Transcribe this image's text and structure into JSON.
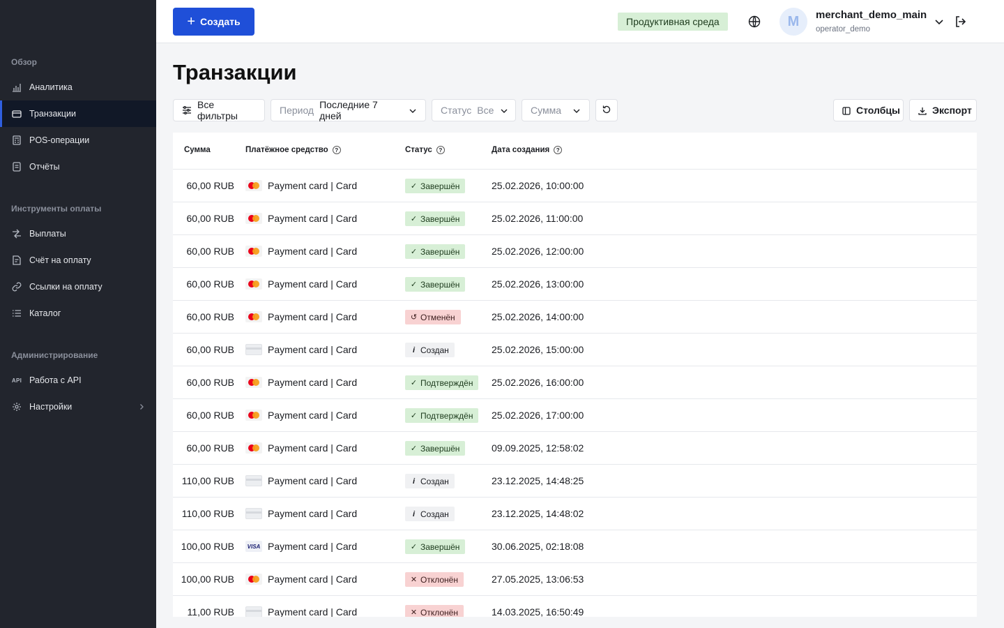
{
  "sidebar": {
    "sections": [
      "Обзор",
      "Инструменты оплаты",
      "Администрирование"
    ],
    "items": [
      {
        "label": "Аналитика",
        "icon": "chart-bars-icon"
      },
      {
        "label": "Транзакции",
        "icon": "wallet-icon",
        "active": true
      },
      {
        "label": "POS-операции",
        "icon": "pos-terminal-icon"
      },
      {
        "label": "Отчёты",
        "icon": "report-icon"
      },
      {
        "label": "Выплаты",
        "icon": "payout-arrow-icon"
      },
      {
        "label": "Счёт на оплату",
        "icon": "invoice-icon"
      },
      {
        "label": "Ссылки на оплату",
        "icon": "link-icon"
      },
      {
        "label": "Каталог",
        "icon": "list-icon"
      },
      {
        "label": "Работа с API",
        "icon": "api-icon",
        "icon_text": "API"
      },
      {
        "label": "Настройки",
        "icon": "gear-icon"
      }
    ]
  },
  "header": {
    "create_label": "Создать",
    "environment": "Продуктивная среда",
    "avatar_letter": "M",
    "account_name": "merchant_demo_main",
    "account_sub": "operator_demo"
  },
  "page": {
    "title": "Транзакции"
  },
  "filters": {
    "all_filters": "Все фильтры",
    "period_label": "Период",
    "period_value": "Последние 7 дней",
    "status_label": "Статус",
    "status_value": "Все",
    "amount_placeholder": "Сумма",
    "columns": "Столбцы",
    "export": "Экспорт"
  },
  "table": {
    "headers": {
      "amount": "Сумма",
      "method": "Платёжное средство",
      "status": "Статус",
      "date": "Дата создания"
    },
    "rows": [
      {
        "amount": "60,00 RUB",
        "card": "mastercard",
        "method": "Payment card | Card",
        "status": "Завершён",
        "status_kind": "ok",
        "date": "25.02.2026, 10:00:00"
      },
      {
        "amount": "60,00 RUB",
        "card": "mastercard",
        "method": "Payment card | Card",
        "status": "Завершён",
        "status_kind": "ok",
        "date": "25.02.2026, 11:00:00"
      },
      {
        "amount": "60,00 RUB",
        "card": "mastercard",
        "method": "Payment card | Card",
        "status": "Завершён",
        "status_kind": "ok",
        "date": "25.02.2026, 12:00:00"
      },
      {
        "amount": "60,00 RUB",
        "card": "mastercard",
        "method": "Payment card | Card",
        "status": "Завершён",
        "status_kind": "ok",
        "date": "25.02.2026, 13:00:00"
      },
      {
        "amount": "60,00 RUB",
        "card": "mastercard",
        "method": "Payment card | Card",
        "status": "Отменён",
        "status_kind": "cancel",
        "date": "25.02.2026, 14:00:00"
      },
      {
        "amount": "60,00 RUB",
        "card": "generic",
        "method": "Payment card | Card",
        "status": "Создан",
        "status_kind": "new",
        "date": "25.02.2026, 15:00:00"
      },
      {
        "amount": "60,00 RUB",
        "card": "mastercard",
        "method": "Payment card | Card",
        "status": "Подтверждён",
        "status_kind": "ok",
        "date": "25.02.2026, 16:00:00"
      },
      {
        "amount": "60,00 RUB",
        "card": "mastercard",
        "method": "Payment card | Card",
        "status": "Подтверждён",
        "status_kind": "ok",
        "date": "25.02.2026, 17:00:00"
      },
      {
        "amount": "60,00 RUB",
        "card": "mastercard",
        "method": "Payment card | Card",
        "status": "Завершён",
        "status_kind": "ok",
        "date": "09.09.2025, 12:58:02"
      },
      {
        "amount": "110,00 RUB",
        "card": "generic",
        "method": "Payment card | Card",
        "status": "Создан",
        "status_kind": "new",
        "date": "23.12.2025, 14:48:25"
      },
      {
        "amount": "110,00 RUB",
        "card": "generic",
        "method": "Payment card | Card",
        "status": "Создан",
        "status_kind": "new",
        "date": "23.12.2025, 14:48:02"
      },
      {
        "amount": "100,00 RUB",
        "card": "visa",
        "card_text": "VISA",
        "method": "Payment card | Card",
        "status": "Завершён",
        "status_kind": "ok",
        "date": "30.06.2025, 02:18:08"
      },
      {
        "amount": "100,00 RUB",
        "card": "mastercard",
        "method": "Payment card | Card",
        "status": "Отклонён",
        "status_kind": "fail",
        "date": "27.05.2025, 13:06:53"
      },
      {
        "amount": "11,00 RUB",
        "card": "generic",
        "method": "Payment card | Card",
        "status": "Отклонён",
        "status_kind": "fail",
        "date": "14.03.2025, 16:50:49"
      }
    ]
  },
  "colors": {
    "sidebar_bg": "#22252d",
    "primary": "#1f4fd8",
    "status_ok_bg": "#d7efd6",
    "status_error_bg": "#f8d2d2",
    "status_neutral_bg": "#f0f1f3"
  }
}
